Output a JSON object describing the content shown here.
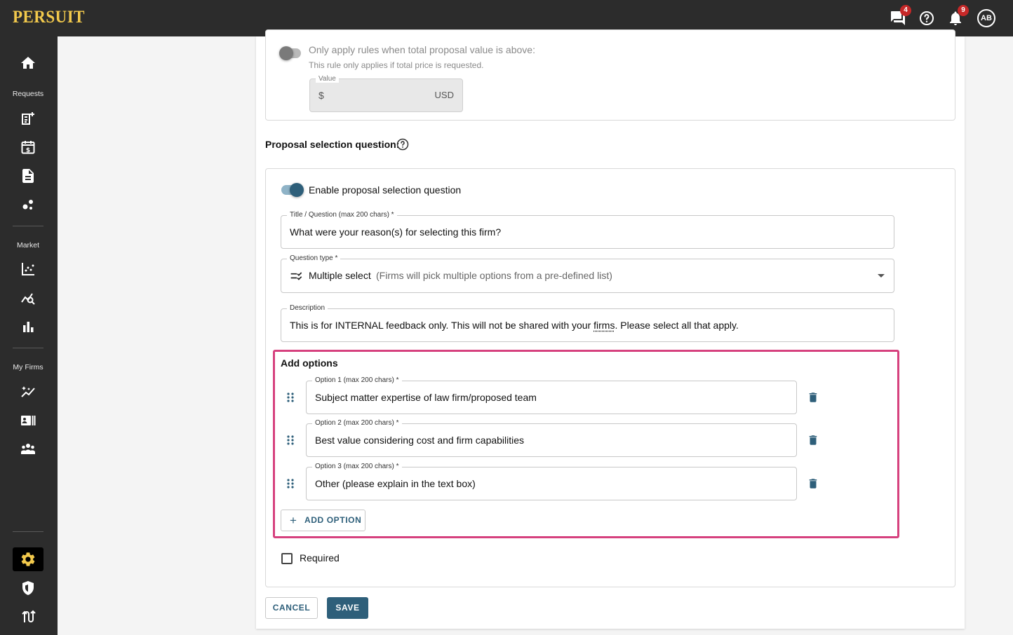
{
  "app": {
    "logo": "PERSUIT"
  },
  "topbar": {
    "messages_count": "4",
    "notifications_count": "9",
    "avatar_initials": "AB",
    "icons": [
      "chat-icon",
      "help-icon",
      "bell-icon"
    ]
  },
  "sidebar": {
    "sections": {
      "requests": "Requests",
      "market": "Market",
      "my_firms": "My Firms"
    },
    "icons": [
      "home-icon",
      "new-request-icon",
      "calendar-dollar-icon",
      "document-icon",
      "network-icon",
      "chart-line-icon",
      "analytics-search-icon",
      "bar-chart-icon",
      "trending-icon",
      "contact-card-icon",
      "groups-icon",
      "gear-icon",
      "shield-icon",
      "routing-icon"
    ]
  },
  "threshold": {
    "label": "Only apply rules when total proposal value is above:",
    "hint": "This rule only applies if total price is requested.",
    "value_label": "Value",
    "currency_symbol": "$",
    "currency_code": "USD",
    "enabled": false
  },
  "selection_question": {
    "heading": "Proposal selection question:",
    "enable_label": "Enable proposal selection question",
    "enabled": true,
    "title_label": "Title / Question (max 200 chars) *",
    "title_value": "What were your reason(s) for selecting this firm?",
    "type_label": "Question type *",
    "type_value": "Multiple select",
    "type_hint": "(Firms will pick multiple options from a pre-defined list)",
    "description_label": "Description",
    "description_before": "This is for INTERNAL feedback only. This will not be shared with your ",
    "description_underlined": "firms",
    "description_after": ". Please select all that apply."
  },
  "options": {
    "heading": "Add options",
    "items": [
      {
        "label": "Option 1 (max 200 chars) *",
        "value": "Subject matter expertise of law firm/proposed team"
      },
      {
        "label": "Option 2 (max 200 chars) *",
        "value": "Best value considering cost and firm capabilities"
      },
      {
        "label": "Option 3 (max 200 chars) *",
        "value": "Other (please explain in the text box)"
      }
    ],
    "add_label": "ADD OPTION"
  },
  "required": {
    "label": "Required",
    "checked": false
  },
  "actions": {
    "cancel": "CANCEL",
    "save": "SAVE"
  },
  "colors": {
    "accent": "#2e5f7a",
    "highlight": "#d6417e",
    "brand": "#f2c94c",
    "badge": "#c62828"
  }
}
